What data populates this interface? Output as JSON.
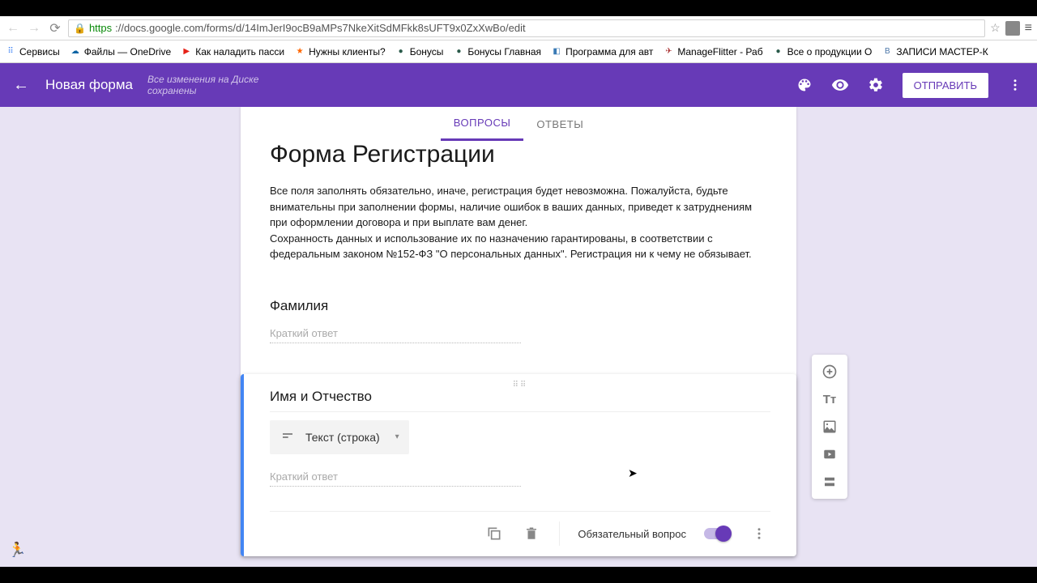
{
  "browser": {
    "url_protocol": "https",
    "url_rest": "://docs.google.com/forms/d/14ImJerI9ocB9aMPs7NkeXitSdMFkk8sUFT9x0ZxXwBo/edit"
  },
  "bookmarks": [
    {
      "icon": "⠿",
      "label": "Сервисы",
      "color": "#4285f4"
    },
    {
      "icon": "☁",
      "label": "Файлы — OneDrive",
      "color": "#0a64a4"
    },
    {
      "icon": "▶",
      "label": "Как наладить пасси",
      "color": "#e62117"
    },
    {
      "icon": "★",
      "label": "Нужны клиенты?",
      "color": "#ff6600"
    },
    {
      "icon": "●",
      "label": "Бонусы",
      "color": "#2a5a4a"
    },
    {
      "icon": "●",
      "label": "Бонусы Главная",
      "color": "#2a5a4a"
    },
    {
      "icon": "◧",
      "label": "Программа для авт",
      "color": "#3a7ab5"
    },
    {
      "icon": "✈",
      "label": "ManageFlitter - Раб",
      "color": "#a33"
    },
    {
      "icon": "●",
      "label": "Все о продукции О",
      "color": "#2a5a4a"
    },
    {
      "icon": "В",
      "label": "ЗАПИСИ МАСТЕР-К",
      "color": "#4a76a8"
    }
  ],
  "header": {
    "form_name": "Новая форма",
    "save_status": "Все изменения на Диске сохранены",
    "send_label": "ОТПРАВИТЬ"
  },
  "tabs": {
    "questions": "ВОПРОСЫ",
    "responses": "ОТВЕТЫ"
  },
  "form": {
    "title": "Форма Регистрации",
    "description": "Все поля заполнять обязательно, иначе, регистрация будет невозможна. Пожалуйста, будьте внимательны при заполнении формы, наличие ошибок в ваших данных, приведет к затруднениям при оформлении договора и при выплате вам денег.\nСохранность данных и использование их по назначению гарантированы, в соответствии с федеральным законом №152-ФЗ \"О персональных данных\". Регистрация ни к чему не обязывает."
  },
  "q1": {
    "title": "Фамилия",
    "placeholder": "Краткий ответ"
  },
  "q2": {
    "title": "Имя и Отчество",
    "type_label": "Текст (строка)",
    "placeholder": "Краткий ответ",
    "required_label": "Обязательный вопрос"
  }
}
